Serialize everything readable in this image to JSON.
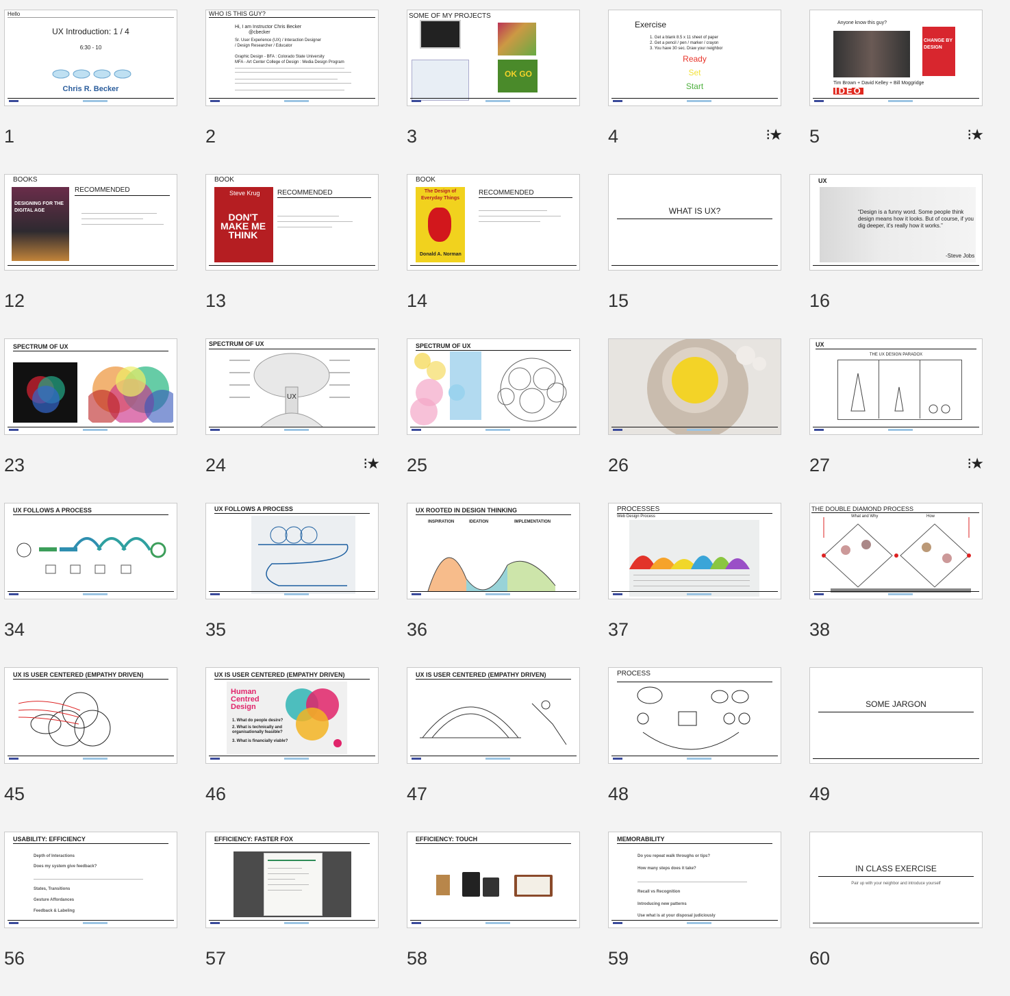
{
  "slides": [
    {
      "num": "1",
      "star": false
    },
    {
      "num": "2",
      "star": false
    },
    {
      "num": "3",
      "star": false
    },
    {
      "num": "4",
      "star": true
    },
    {
      "num": "5",
      "star": true
    },
    {
      "num": "12",
      "star": false
    },
    {
      "num": "13",
      "star": false
    },
    {
      "num": "14",
      "star": false
    },
    {
      "num": "15",
      "star": false
    },
    {
      "num": "16",
      "star": false
    },
    {
      "num": "23",
      "star": false
    },
    {
      "num": "24",
      "star": true
    },
    {
      "num": "25",
      "star": false
    },
    {
      "num": "26",
      "star": false
    },
    {
      "num": "27",
      "star": true
    },
    {
      "num": "34",
      "star": false
    },
    {
      "num": "35",
      "star": false
    },
    {
      "num": "36",
      "star": false
    },
    {
      "num": "37",
      "star": false
    },
    {
      "num": "38",
      "star": false
    },
    {
      "num": "45",
      "star": false
    },
    {
      "num": "46",
      "star": false
    },
    {
      "num": "47",
      "star": false
    },
    {
      "num": "48",
      "star": false
    },
    {
      "num": "49",
      "star": false
    },
    {
      "num": "56",
      "star": false
    },
    {
      "num": "57",
      "star": false
    },
    {
      "num": "58",
      "star": false
    },
    {
      "num": "59",
      "star": false
    },
    {
      "num": "60",
      "star": false
    }
  ],
  "star_glyph": "⁝★",
  "texts": {
    "s1_hello": "Hello",
    "s1_title": "UX Introduction: 1 / 4",
    "s1_time": "6:30 - 10",
    "s1_name": "Chris R. Becker",
    "s2_title": "WHO IS THIS GUY?",
    "s2_l1": "Hi, I am Instructor Chris Becker",
    "s2_l2": "@cbecker",
    "s2_l3": "Sr. User Experience (UX) / Interaction Designer",
    "s2_l4": "/ Design Researcher / Educator",
    "s2_l5": "Graphic Design - BFA : Colorado State University",
    "s2_l6": "MFA - Art Center College of Design : Media Design Program",
    "s3_title": "SOME OF MY PROJECTS",
    "s4_title": "Exercise",
    "s4_l1": "1.  Get a blank 8.5 x 11 sheet of paper",
    "s4_l2": "2.  Get a pencil / pen / marker / crayon",
    "s4_l3": "3.  You have 30 sec. Draw your neighbor",
    "s4_ready": "Ready",
    "s4_set": "Set",
    "s4_start": "Start",
    "s5_q": "Anyone know this guy?",
    "s5_names": "Tim Brown + David Kelley + Bill Moggridge",
    "s5_book": "CHANGE BY DESIGN",
    "s5_ideo": "IDEO",
    "s12_label": "BOOKS",
    "s12_rec": "RECOMMENDED",
    "s12_cover": "DESIGNING FOR THE DIGITAL AGE",
    "s13_label": "BOOK",
    "s13_rec": "RECOMMENDED",
    "s13_author": "Steve Krug",
    "s13_cover": "DON'T MAKE ME THINK",
    "s14_label": "BOOK",
    "s14_rec": "RECOMMENDED",
    "s14_cover": "The Design of Everyday Things",
    "s14_author": "Donald A. Norman",
    "s15_title": "WHAT IS UX?",
    "s16_label": "UX",
    "s16_quote": "“Design is a funny word. Some people think design means how it looks. But of course, if you dig deeper, it's really how it works.”",
    "s16_attr": "-Steve Jobs",
    "s23_title": "SPECTRUM OF UX",
    "s24_title": "SPECTRUM OF UX",
    "s24_ux": "UX",
    "s25_title": "SPECTRUM OF UX",
    "s27_label": "UX",
    "s27_cap": "THE UX DESIGN PARADOX",
    "s34_title": "UX FOLLOWS A PROCESS",
    "s35_title": "UX FOLLOWS A PROCESS",
    "s36_title": "UX ROOTED IN DESIGN THINKING",
    "s36_c1": "INSPIRATION",
    "s36_c2": "IDEATION",
    "s36_c3": "IMPLEMENTATION",
    "s37_title": "PROCESSES",
    "s37_sub": "Web Design Process",
    "s38_title": "THE DOUBLE DIAMOND PROCESS",
    "s38_a": "What and Why",
    "s38_b": "How",
    "s45_title": "UX IS USER CENTERED (EMPATHY DRIVEN)",
    "s46_title": "UX IS USER CENTERED (EMPATHY DRIVEN)",
    "s46_hcd": "Human Centred Design",
    "s46_q1": "1. What do people desire?",
    "s46_q2": "2. What is technically and organisationally feasible?",
    "s46_q3": "3. What is financially viable?",
    "s47_title": "UX IS USER CENTERED (EMPATHY DRIVEN)",
    "s48_title": "PROCESS",
    "s49_title": "SOME JARGON",
    "s56_title": "USABILITY: EFFICIENCY",
    "s56_l1": "Depth of Interactions",
    "s56_l2": "Does my system give feedback?",
    "s56_l3": "States, Transitions",
    "s56_l4": "Gesture Affordances",
    "s56_l5": "Feedback & Labeling",
    "s57_title": "EFFICIENCY: FASTER FOX",
    "s58_title": "EFFICIENCY: TOUCH",
    "s59_title": "MEMORABILITY",
    "s59_l1": "Do you repeat walk throughs or tips?",
    "s59_l2": "How many steps does it take?",
    "s59_l3": "Recall vs Recognition",
    "s59_l4": "Introducing new patterns",
    "s59_l5": "Use what is at your disposal judiciously",
    "s60_title": "IN CLASS EXERCISE",
    "s60_sub": "Pair up with your neighbor and introduce yourself"
  }
}
